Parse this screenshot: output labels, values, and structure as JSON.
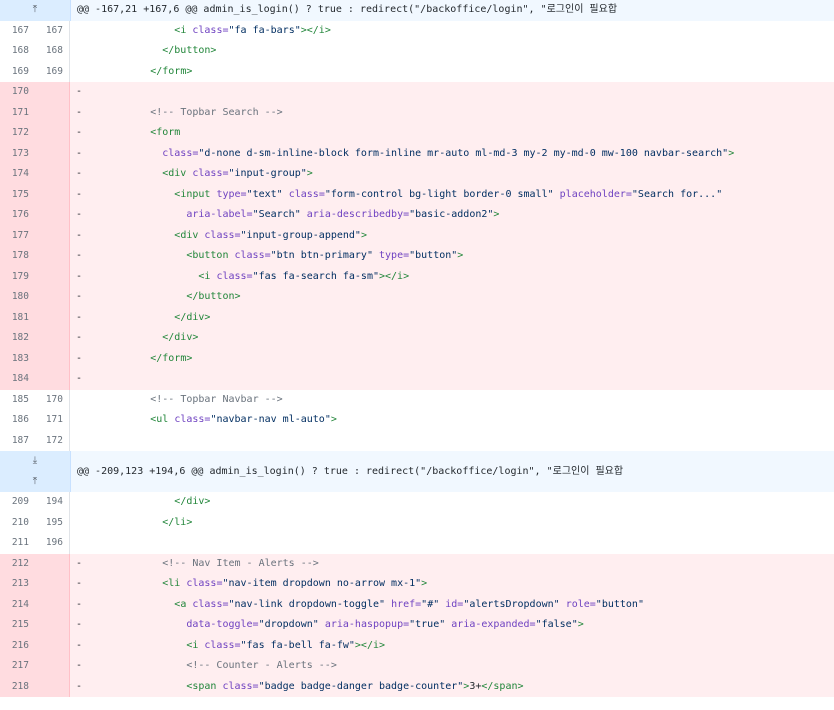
{
  "diff": {
    "lines": [
      {
        "type": "hunk",
        "icons": [
          "expand-up-icon"
        ],
        "header": "@@ -167,21 +167,6 @@ admin_is_login() ? true : redirect(\"/backoffice/login\", \"로그인이 필요합"
      },
      {
        "type": "ctx",
        "old": "167",
        "new": "167",
        "indent": 14,
        "tokens": [
          {
            "k": "tag",
            "t": "<i "
          },
          {
            "k": "attr",
            "t": "class="
          },
          {
            "k": "str",
            "t": "\"fa fa-bars\""
          },
          {
            "k": "tag",
            "t": "></i>"
          }
        ]
      },
      {
        "type": "ctx",
        "old": "168",
        "new": "168",
        "indent": 12,
        "tokens": [
          {
            "k": "tag",
            "t": "</button>"
          }
        ]
      },
      {
        "type": "ctx",
        "old": "169",
        "new": "169",
        "indent": 10,
        "tokens": [
          {
            "k": "tag",
            "t": "</form>"
          }
        ]
      },
      {
        "type": "del",
        "old": "170",
        "new": "",
        "indent": 0,
        "tokens": []
      },
      {
        "type": "del",
        "old": "171",
        "new": "",
        "indent": 10,
        "tokens": [
          {
            "k": "cmt",
            "t": "<!-- Topbar Search -->"
          }
        ]
      },
      {
        "type": "del",
        "old": "172",
        "new": "",
        "indent": 10,
        "tokens": [
          {
            "k": "tag",
            "t": "<form"
          }
        ]
      },
      {
        "type": "del",
        "old": "173",
        "new": "",
        "indent": 12,
        "tokens": [
          {
            "k": "attr",
            "t": "class="
          },
          {
            "k": "str",
            "t": "\"d-none d-sm-inline-block form-inline mr-auto ml-md-3 my-2 my-md-0 mw-100 navbar-search\""
          },
          {
            "k": "tag",
            "t": ">"
          }
        ]
      },
      {
        "type": "del",
        "old": "174",
        "new": "",
        "indent": 12,
        "tokens": [
          {
            "k": "tag",
            "t": "<div "
          },
          {
            "k": "attr",
            "t": "class="
          },
          {
            "k": "str",
            "t": "\"input-group\""
          },
          {
            "k": "tag",
            "t": ">"
          }
        ]
      },
      {
        "type": "del",
        "old": "175",
        "new": "",
        "indent": 14,
        "tokens": [
          {
            "k": "tag",
            "t": "<input "
          },
          {
            "k": "attr",
            "t": "type="
          },
          {
            "k": "str",
            "t": "\"text\""
          },
          {
            "k": "txt",
            "t": " "
          },
          {
            "k": "attr",
            "t": "class="
          },
          {
            "k": "str",
            "t": "\"form-control bg-light border-0 small\""
          },
          {
            "k": "txt",
            "t": " "
          },
          {
            "k": "attr",
            "t": "placeholder="
          },
          {
            "k": "str",
            "t": "\"Search for...\""
          }
        ]
      },
      {
        "type": "del",
        "old": "176",
        "new": "",
        "indent": 16,
        "tokens": [
          {
            "k": "attr",
            "t": "aria-label="
          },
          {
            "k": "str",
            "t": "\"Search\""
          },
          {
            "k": "txt",
            "t": " "
          },
          {
            "k": "attr",
            "t": "aria-describedby="
          },
          {
            "k": "str",
            "t": "\"basic-addon2\""
          },
          {
            "k": "tag",
            "t": ">"
          }
        ]
      },
      {
        "type": "del",
        "old": "177",
        "new": "",
        "indent": 14,
        "tokens": [
          {
            "k": "tag",
            "t": "<div "
          },
          {
            "k": "attr",
            "t": "class="
          },
          {
            "k": "str",
            "t": "\"input-group-append\""
          },
          {
            "k": "tag",
            "t": ">"
          }
        ]
      },
      {
        "type": "del",
        "old": "178",
        "new": "",
        "indent": 16,
        "tokens": [
          {
            "k": "tag",
            "t": "<button "
          },
          {
            "k": "attr",
            "t": "class="
          },
          {
            "k": "str",
            "t": "\"btn btn-primary\""
          },
          {
            "k": "txt",
            "t": " "
          },
          {
            "k": "attr",
            "t": "type="
          },
          {
            "k": "str",
            "t": "\"button\""
          },
          {
            "k": "tag",
            "t": ">"
          }
        ]
      },
      {
        "type": "del",
        "old": "179",
        "new": "",
        "indent": 18,
        "tokens": [
          {
            "k": "tag",
            "t": "<i "
          },
          {
            "k": "attr",
            "t": "class="
          },
          {
            "k": "str",
            "t": "\"fas fa-search fa-sm\""
          },
          {
            "k": "tag",
            "t": "></i>"
          }
        ]
      },
      {
        "type": "del",
        "old": "180",
        "new": "",
        "indent": 16,
        "tokens": [
          {
            "k": "tag",
            "t": "</button>"
          }
        ]
      },
      {
        "type": "del",
        "old": "181",
        "new": "",
        "indent": 14,
        "tokens": [
          {
            "k": "tag",
            "t": "</div>"
          }
        ]
      },
      {
        "type": "del",
        "old": "182",
        "new": "",
        "indent": 12,
        "tokens": [
          {
            "k": "tag",
            "t": "</div>"
          }
        ]
      },
      {
        "type": "del",
        "old": "183",
        "new": "",
        "indent": 10,
        "tokens": [
          {
            "k": "tag",
            "t": "</form>"
          }
        ]
      },
      {
        "type": "del",
        "old": "184",
        "new": "",
        "indent": 0,
        "tokens": []
      },
      {
        "type": "ctx",
        "old": "185",
        "new": "170",
        "indent": 10,
        "tokens": [
          {
            "k": "cmt",
            "t": "<!-- Topbar Navbar -->"
          }
        ]
      },
      {
        "type": "ctx",
        "old": "186",
        "new": "171",
        "indent": 10,
        "tokens": [
          {
            "k": "tag",
            "t": "<ul "
          },
          {
            "k": "attr",
            "t": "class="
          },
          {
            "k": "str",
            "t": "\"navbar-nav ml-auto\""
          },
          {
            "k": "tag",
            "t": ">"
          }
        ]
      },
      {
        "type": "ctx",
        "old": "187",
        "new": "172",
        "indent": 0,
        "tokens": []
      },
      {
        "type": "hunk",
        "icons": [
          "expand-down-icon",
          "expand-up-icon"
        ],
        "header": "@@ -209,123 +194,6 @@ admin_is_login() ? true : redirect(\"/backoffice/login\", \"로그인이 필요합"
      },
      {
        "type": "ctx",
        "old": "209",
        "new": "194",
        "indent": 14,
        "tokens": [
          {
            "k": "tag",
            "t": "</div>"
          }
        ]
      },
      {
        "type": "ctx",
        "old": "210",
        "new": "195",
        "indent": 12,
        "tokens": [
          {
            "k": "tag",
            "t": "</li>"
          }
        ]
      },
      {
        "type": "ctx",
        "old": "211",
        "new": "196",
        "indent": 0,
        "tokens": []
      },
      {
        "type": "del",
        "old": "212",
        "new": "",
        "indent": 12,
        "tokens": [
          {
            "k": "cmt",
            "t": "<!-- Nav Item - Alerts -->"
          }
        ]
      },
      {
        "type": "del",
        "old": "213",
        "new": "",
        "indent": 12,
        "tokens": [
          {
            "k": "tag",
            "t": "<li "
          },
          {
            "k": "attr",
            "t": "class="
          },
          {
            "k": "str",
            "t": "\"nav-item dropdown no-arrow mx-1\""
          },
          {
            "k": "tag",
            "t": ">"
          }
        ]
      },
      {
        "type": "del",
        "old": "214",
        "new": "",
        "indent": 14,
        "tokens": [
          {
            "k": "tag",
            "t": "<a "
          },
          {
            "k": "attr",
            "t": "class="
          },
          {
            "k": "str",
            "t": "\"nav-link dropdown-toggle\""
          },
          {
            "k": "txt",
            "t": " "
          },
          {
            "k": "attr",
            "t": "href="
          },
          {
            "k": "str",
            "t": "\"#\""
          },
          {
            "k": "txt",
            "t": " "
          },
          {
            "k": "attr",
            "t": "id="
          },
          {
            "k": "str",
            "t": "\"alertsDropdown\""
          },
          {
            "k": "txt",
            "t": " "
          },
          {
            "k": "attr",
            "t": "role="
          },
          {
            "k": "str",
            "t": "\"button\""
          }
        ]
      },
      {
        "type": "del",
        "old": "215",
        "new": "",
        "indent": 16,
        "tokens": [
          {
            "k": "attr",
            "t": "data-toggle="
          },
          {
            "k": "str",
            "t": "\"dropdown\""
          },
          {
            "k": "txt",
            "t": " "
          },
          {
            "k": "attr",
            "t": "aria-haspopup="
          },
          {
            "k": "str",
            "t": "\"true\""
          },
          {
            "k": "txt",
            "t": " "
          },
          {
            "k": "attr",
            "t": "aria-expanded="
          },
          {
            "k": "str",
            "t": "\"false\""
          },
          {
            "k": "tag",
            "t": ">"
          }
        ]
      },
      {
        "type": "del",
        "old": "216",
        "new": "",
        "indent": 16,
        "tokens": [
          {
            "k": "tag",
            "t": "<i "
          },
          {
            "k": "attr",
            "t": "class="
          },
          {
            "k": "str",
            "t": "\"fas fa-bell fa-fw\""
          },
          {
            "k": "tag",
            "t": "></i>"
          }
        ]
      },
      {
        "type": "del",
        "old": "217",
        "new": "",
        "indent": 16,
        "tokens": [
          {
            "k": "cmt",
            "t": "<!-- Counter - Alerts -->"
          }
        ]
      },
      {
        "type": "del",
        "old": "218",
        "new": "",
        "indent": 16,
        "tokens": [
          {
            "k": "tag",
            "t": "<span "
          },
          {
            "k": "attr",
            "t": "class="
          },
          {
            "k": "str",
            "t": "\"badge badge-danger badge-counter\""
          },
          {
            "k": "tag",
            "t": ">"
          },
          {
            "k": "txt",
            "t": "3+"
          },
          {
            "k": "tag",
            "t": "</span>"
          }
        ]
      }
    ]
  }
}
